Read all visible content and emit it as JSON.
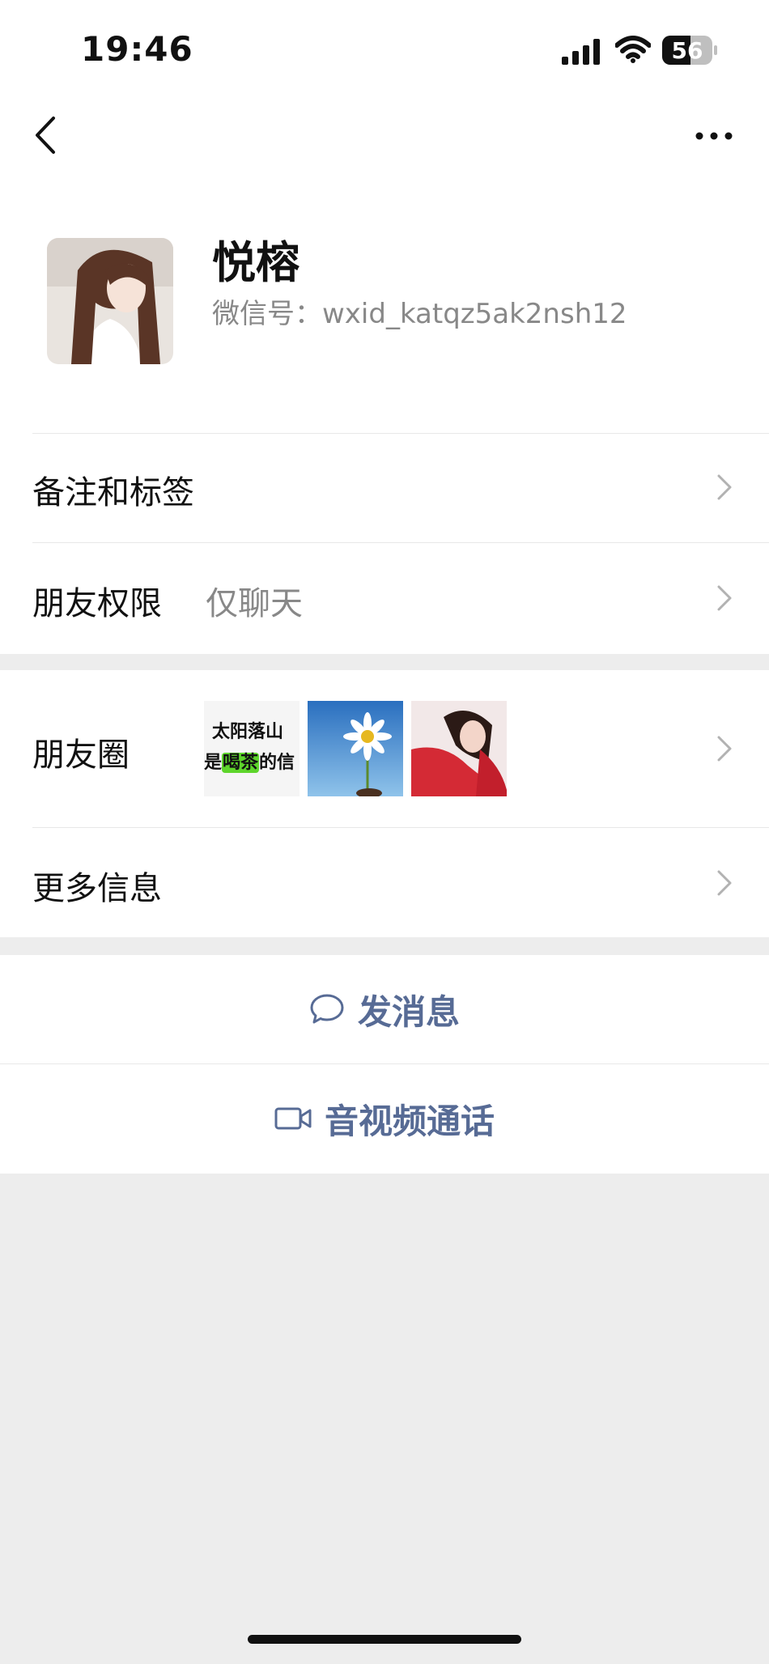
{
  "status_bar": {
    "time": "19:46",
    "battery": "56"
  },
  "profile": {
    "name": "悦榕",
    "wechat_id": "微信号：wxid_katqz5ak2nsh12"
  },
  "rows": {
    "remarks_tags": "备注和标签",
    "friend_permissions": {
      "label": "朋友权限",
      "value": "仅聊天"
    },
    "moments": {
      "label": "朋友圈"
    },
    "more_info": "更多信息"
  },
  "moments_thumbnails": {
    "thumb1_line1": "太阳落山",
    "thumb1_line2_a": "是",
    "thumb1_line2_highlight": "喝茶",
    "thumb1_line2_b": "的信"
  },
  "actions": {
    "send_message": "发消息",
    "av_call": "音视频通话"
  },
  "colors": {
    "link_blue": "#576b95",
    "background_gray": "#ededed"
  }
}
